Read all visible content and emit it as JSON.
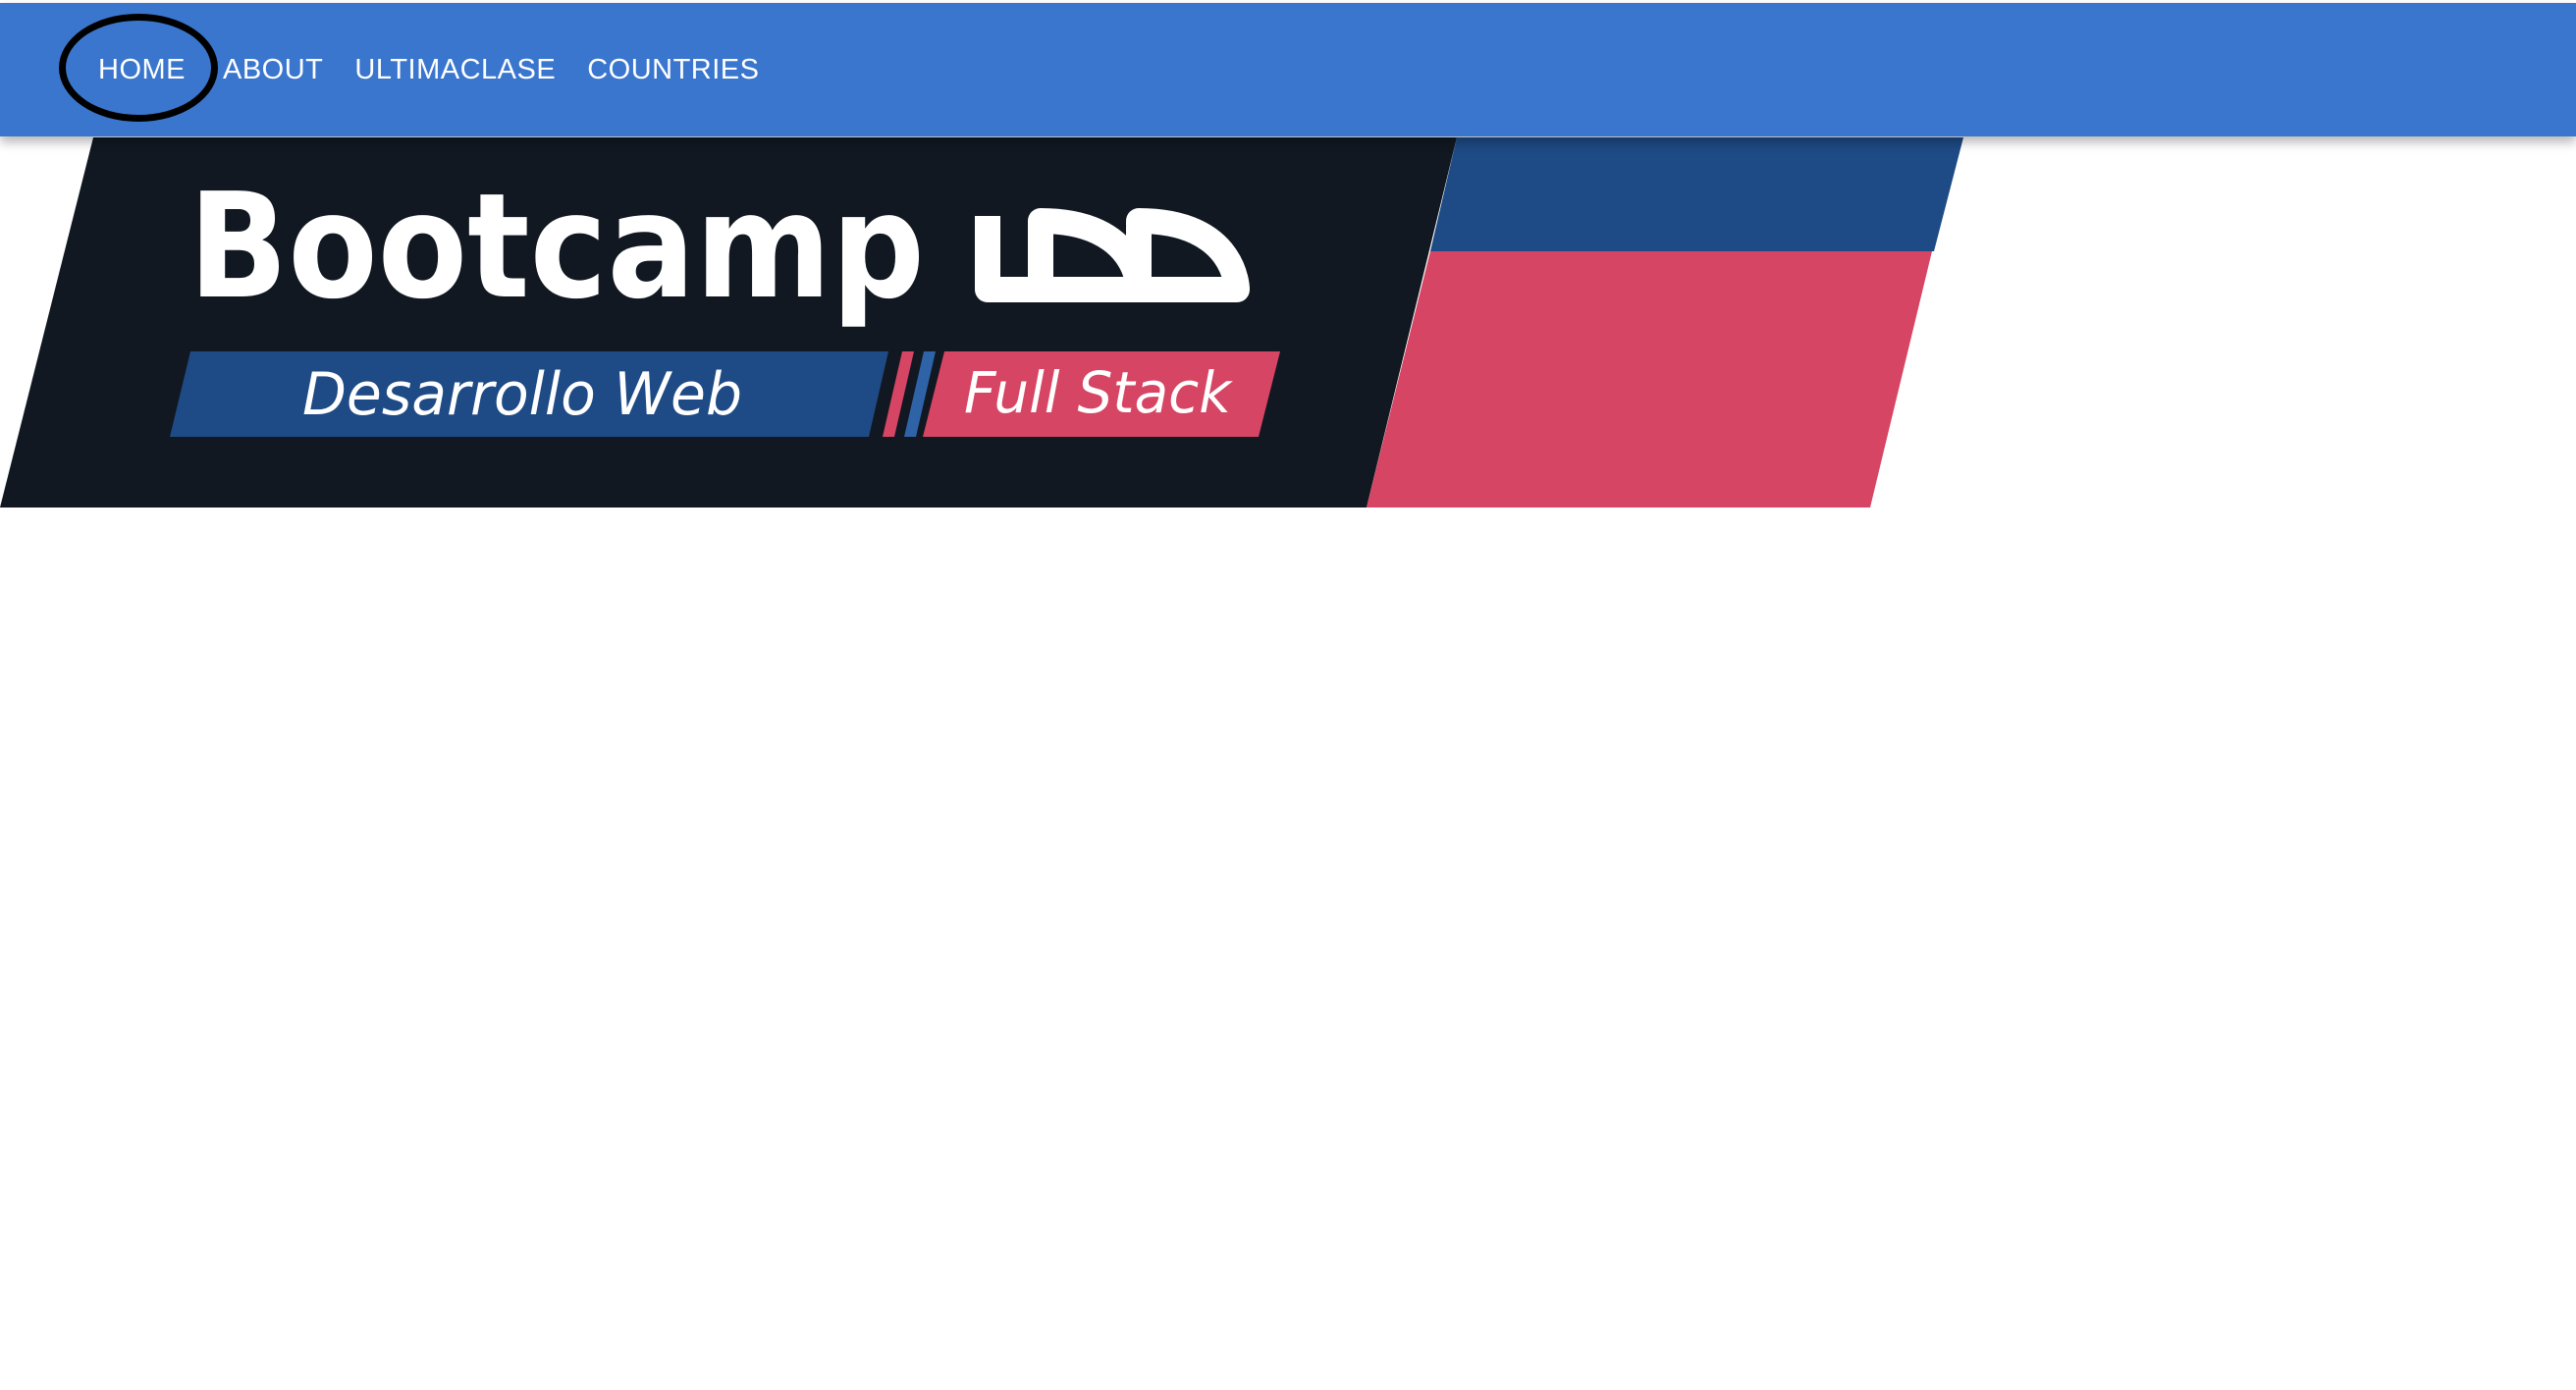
{
  "navbar": {
    "background_color": "#3a76cd",
    "items": [
      {
        "label": "HOME",
        "active": true
      },
      {
        "label": "ABOUT"
      },
      {
        "label": "ULTIMACLASE"
      },
      {
        "label": "COUNTRIES"
      }
    ]
  },
  "banner": {
    "title": "Bootcamp",
    "logo_text": "UDD",
    "subtitle_left": "Desarrollo Web",
    "subtitle_right": "Full Stack",
    "colors": {
      "dark": "#111821",
      "blue": "#1e4a85",
      "pink": "#d64563",
      "white": "#ffffff"
    }
  }
}
